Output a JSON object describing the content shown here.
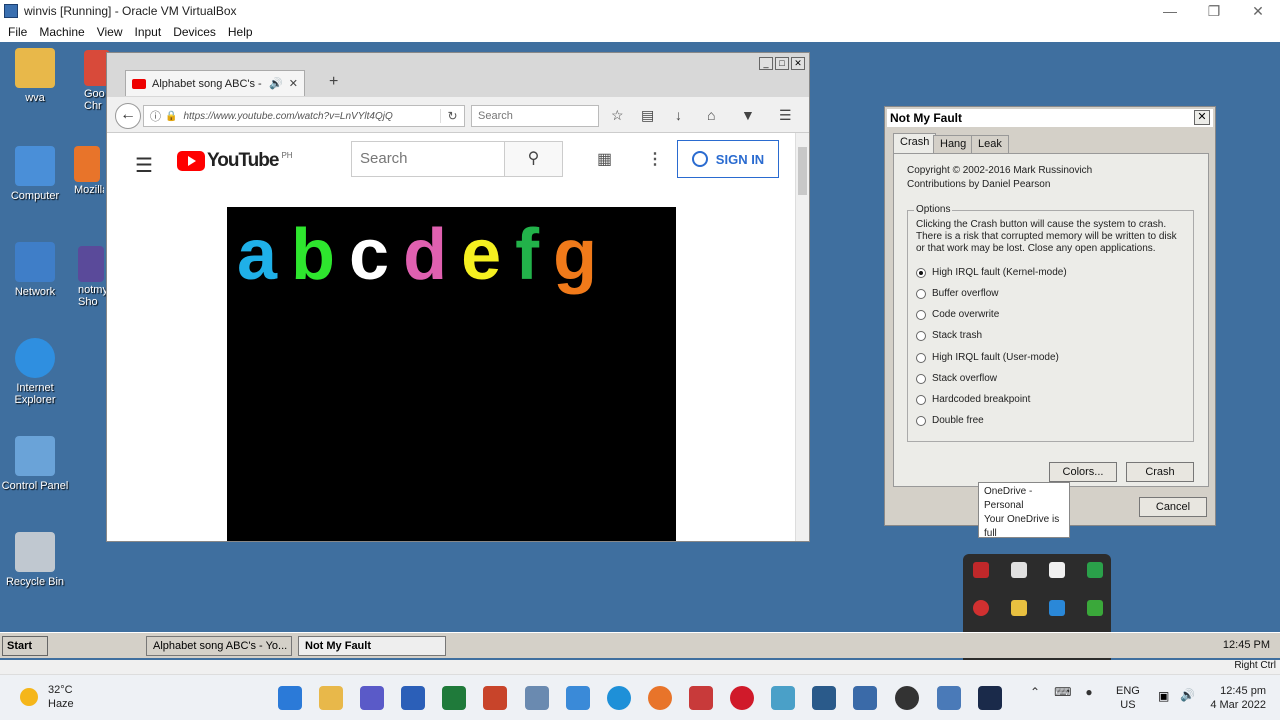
{
  "vbox": {
    "title": "winvis [Running] - Oracle VM VirtualBox",
    "menu": [
      "File",
      "Machine",
      "View",
      "Input",
      "Devices",
      "Help"
    ],
    "host_key": "Right Ctrl"
  },
  "desktop": {
    "icons": [
      {
        "label": "wva",
        "color": "#e8b84a"
      },
      {
        "label": "Computer",
        "color": "#4a8fd8"
      },
      {
        "label": "Network",
        "color": "#3f7ec8"
      },
      {
        "label": "Internet Explorer",
        "color": "#2f8fe0"
      },
      {
        "label": "Control Panel",
        "color": "#6aa3d8"
      },
      {
        "label": "Recycle Bin",
        "color": "#c0c8d0"
      }
    ],
    "partial_icons": [
      {
        "label": "Goo Chr",
        "color": "#d84a3a"
      },
      {
        "label": "Mozilla",
        "color": "#e8742a"
      },
      {
        "label": "notmy Sho",
        "color": "#5a4a9a"
      }
    ]
  },
  "firefox": {
    "tab_title": "Alphabet song ABC's - Yo...",
    "url": "https://www.youtube.com/watch?v=LnVYlt4QjQ",
    "search_placeholder": "Search",
    "youtube": {
      "logo_text": "YouTube",
      "region": "PH",
      "search_placeholder": "Search",
      "sign_in": "SIGN IN",
      "letters": [
        {
          "char": "a",
          "color": "#1fb0e8"
        },
        {
          "char": "b",
          "color": "#2ee62e"
        },
        {
          "char": "c",
          "color": "#ffffff"
        },
        {
          "char": "d",
          "color": "#e060b0"
        },
        {
          "char": "e",
          "color": "#f5f020"
        },
        {
          "char": "f",
          "color": "#22b24a"
        },
        {
          "char": "g",
          "color": "#f07a1a"
        }
      ]
    }
  },
  "notmyfault": {
    "title": "Not My Fault",
    "tabs": [
      "Crash",
      "Hang",
      "Leak"
    ],
    "copyright": "Copyright © 2002-2016 Mark Russinovich",
    "contributions": "Contributions by Daniel Pearson",
    "options_legend": "Options",
    "description": "Clicking the Crash button will cause the system to crash. There is a risk that corrupted memory will be written to disk or that work may be lost. Close any open applications.",
    "options": [
      {
        "label": "High IRQL fault (Kernel-mode)",
        "selected": true
      },
      {
        "label": "Buffer overflow",
        "selected": false
      },
      {
        "label": "Code overwrite",
        "selected": false
      },
      {
        "label": "Stack trash",
        "selected": false
      },
      {
        "label": "High IRQL fault (User-mode)",
        "selected": false
      },
      {
        "label": "Stack overflow",
        "selected": false
      },
      {
        "label": "Hardcoded breakpoint",
        "selected": false
      },
      {
        "label": "Double free",
        "selected": false
      }
    ],
    "colors_button": "Colors...",
    "crash_button": "Crash",
    "cancel_button": "Cancel"
  },
  "tooltip": {
    "line1": "OneDrive -",
    "line2": "Personal",
    "line3": "Your OneDrive is",
    "line4": "full"
  },
  "guest_taskbar": {
    "start": "Start",
    "task1": "Alphabet song ABC's - Yo...",
    "task2": "Not My Fault",
    "clock": "12:45 PM"
  },
  "host_taskbar": {
    "temperature": "32°C",
    "weather": "Haze",
    "lang1": "ENG",
    "lang2": "US",
    "time": "12:45 pm",
    "date": "4 Mar 2022"
  }
}
